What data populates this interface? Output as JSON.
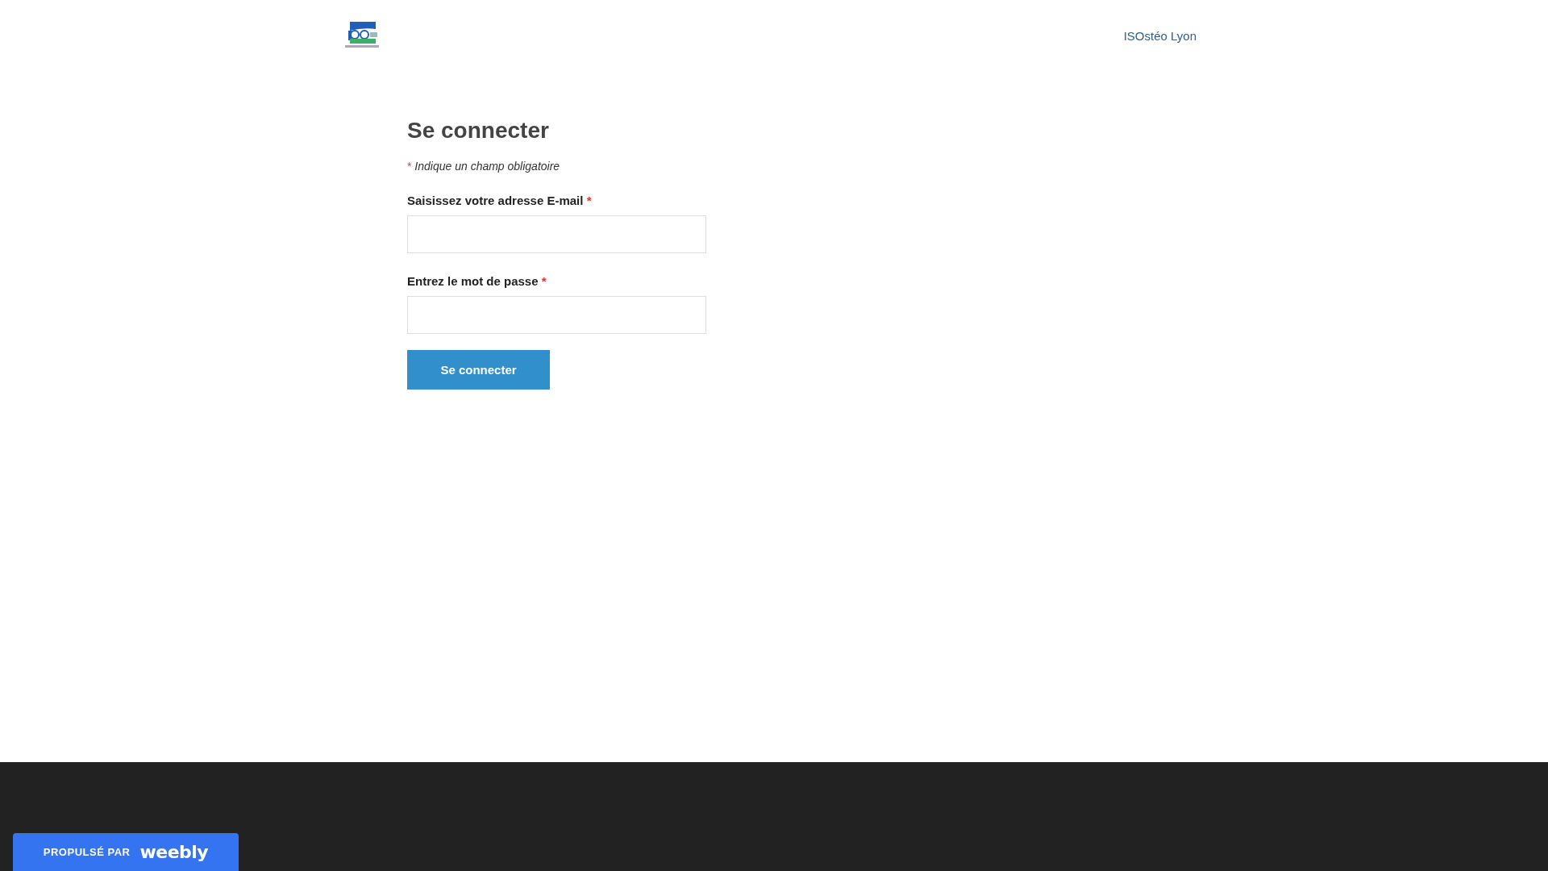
{
  "header": {
    "nav_link": "ISOstéo Lyon"
  },
  "form": {
    "title": "Se connecter",
    "required_mark": "*",
    "required_note": "Indique un champ obligatoire",
    "fields": [
      {
        "label": "Saisissez votre adresse E-mail",
        "required": true
      },
      {
        "label": "Entrez le mot de passe",
        "required": true
      }
    ],
    "submit": "Se connecter"
  },
  "footer_badge": {
    "prefix": "PROPULSÉ PAR",
    "brand": "weebly"
  }
}
